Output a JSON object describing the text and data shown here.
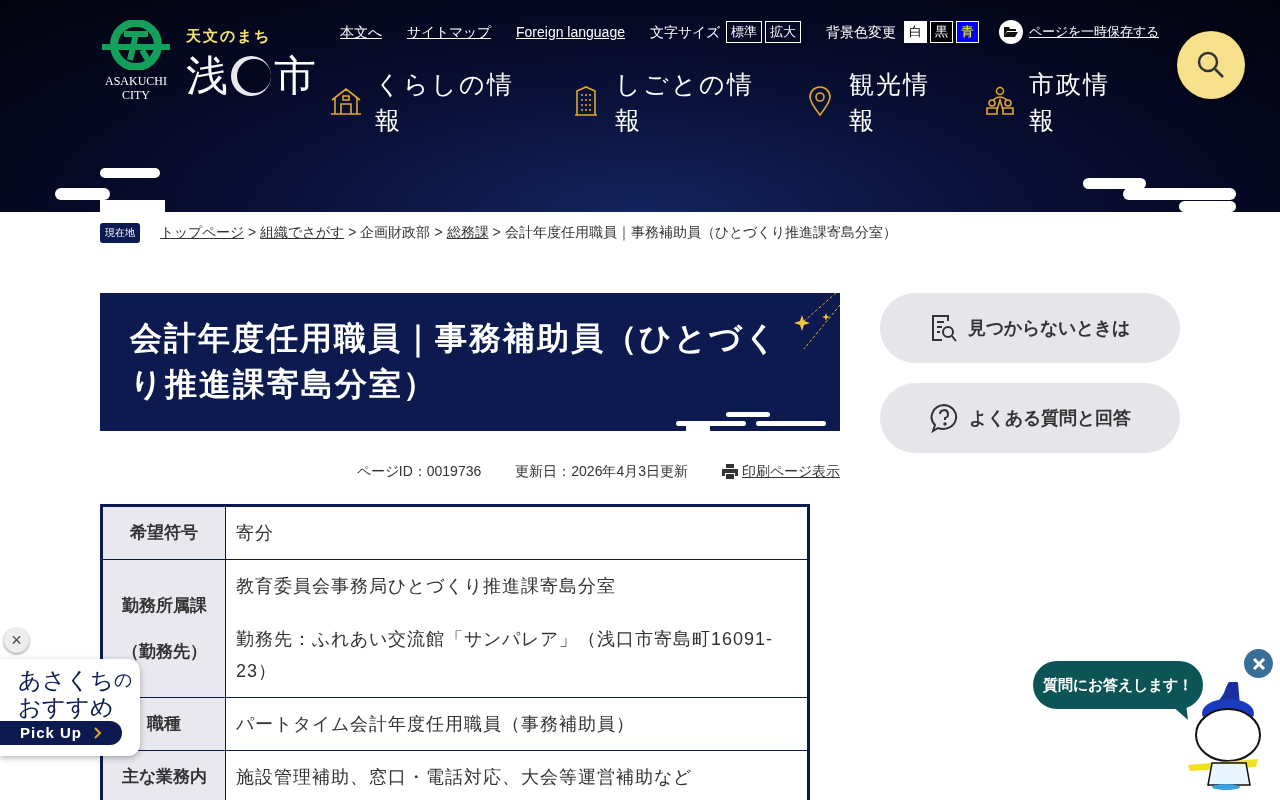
{
  "header": {
    "logo_city": "ASAKUCHI CITY",
    "tagline": "天文のまち",
    "city_name_left": "浅",
    "city_name_right": "市",
    "utility_links": [
      "本文へ",
      "サイトマップ",
      "Foreign language"
    ],
    "font_size": {
      "label": "文字サイズ",
      "options": [
        "標準",
        "拡大"
      ]
    },
    "background": {
      "label": "背景色変更",
      "options": [
        {
          "label": "白",
          "kind": "white"
        },
        {
          "label": "黒",
          "kind": "black"
        },
        {
          "label": "青",
          "kind": "blue"
        }
      ]
    },
    "save_link": "ページを一時保存する",
    "nav": [
      {
        "label": "くらしの情報",
        "kind": "house"
      },
      {
        "label": "しごとの情報",
        "kind": "building"
      },
      {
        "label": "観光情報",
        "kind": "pin"
      },
      {
        "label": "市政情報",
        "kind": "people"
      }
    ]
  },
  "breadcrumb": {
    "badge": "現在地",
    "separator": ">",
    "items": [
      {
        "label": "トップページ",
        "link": true
      },
      {
        "label": "組織でさがす",
        "link": true
      },
      {
        "label": "企画財政部",
        "link": false
      },
      {
        "label": "総務課",
        "link": true
      },
      {
        "label": "会計年度任用職員｜事務補助員（ひとづくり推進課寄島分室）",
        "link": false
      }
    ]
  },
  "page": {
    "title": "会計年度任用職員｜事務補助員（ひとづくり推進課寄島分室）",
    "page_id": "ページID：0019736",
    "updated": "更新日：2026年4月3日更新",
    "print_link": "印刷ページ表示"
  },
  "table": {
    "rows": [
      {
        "header": "希望符号",
        "values": [
          "寄分"
        ]
      },
      {
        "header": "勤務所属課（勤務先）",
        "values": [
          "教育委員会事務局ひとづくり推進課寄島分室",
          "勤務先：ふれあい交流館「サンパレア」（浅口市寄島町16091-23）"
        ]
      },
      {
        "header": "職種",
        "values": [
          "パートタイム会計年度任用職員（事務補助員）"
        ]
      },
      {
        "header": "主な業務内",
        "values": [
          "施設管理補助、窓口・電話対応、大会等運営補助など"
        ]
      }
    ]
  },
  "side_buttons": [
    {
      "label": "見つからないときは",
      "kind": "search-doc"
    },
    {
      "label": "よくある質問と回答",
      "kind": "question"
    }
  ],
  "pickup": {
    "close": "×",
    "title_main": "あさくち",
    "title_small": "の",
    "title_line2": "おすすめ",
    "button": "Pick Up"
  },
  "chatbot": {
    "bubble": "質問にお答えします！"
  }
}
